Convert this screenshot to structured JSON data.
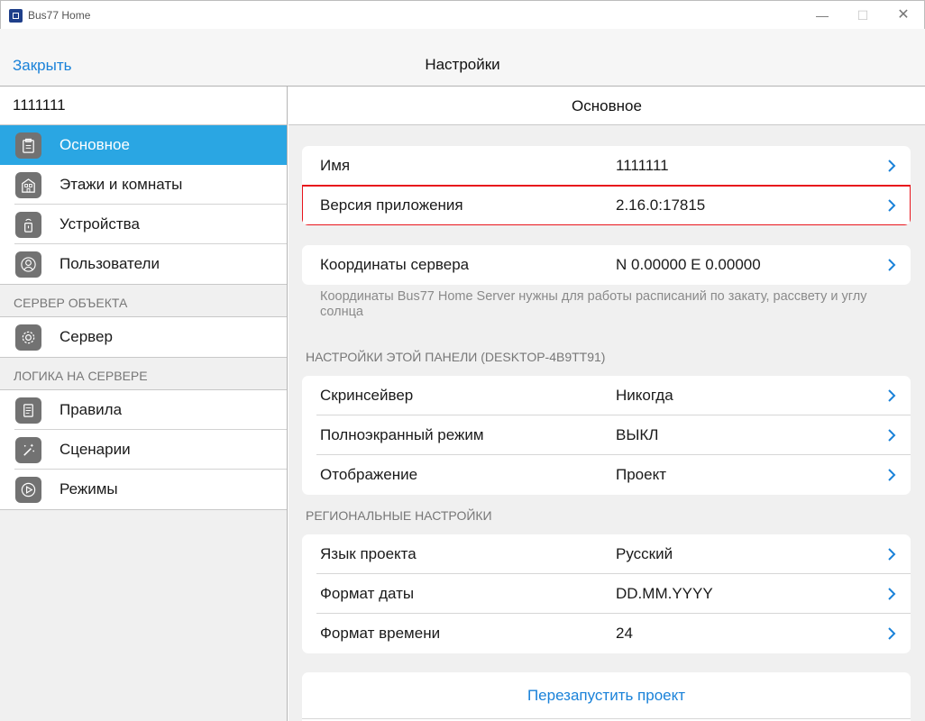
{
  "window": {
    "title": "Bus77 Home",
    "minimize": "—",
    "maximize": "☐",
    "close": "✕"
  },
  "nav": {
    "close_label": "Закрыть",
    "title": "Настройки"
  },
  "sidebar": {
    "header": "1111111",
    "items": [
      {
        "label": "Основное",
        "icon": "clipboard-icon"
      },
      {
        "label": "Этажи и комнаты",
        "icon": "building-icon"
      },
      {
        "label": "Устройства",
        "icon": "device-icon"
      },
      {
        "label": "Пользователи",
        "icon": "user-icon"
      }
    ],
    "section_server": "СЕРВЕР ОБЪЕКТА",
    "server_items": [
      {
        "label": "Сервер",
        "icon": "gear-icon"
      }
    ],
    "section_logic": "ЛОГИКА НА СЕРВЕРЕ",
    "logic_items": [
      {
        "label": "Правила",
        "icon": "document-icon"
      },
      {
        "label": "Сценарии",
        "icon": "magic-wand-icon"
      },
      {
        "label": "Режимы",
        "icon": "play-icon"
      }
    ]
  },
  "main": {
    "header": "Основное",
    "group1": [
      {
        "label": "Имя",
        "value": "1111111"
      },
      {
        "label": "Версия приложения",
        "value": "2.16.0:17815"
      }
    ],
    "group2": [
      {
        "label": "Координаты сервера",
        "value": "N 0.00000 E 0.00000"
      }
    ],
    "group2_note": "Координаты Bus77 Home Server нужны для работы расписаний по закату, рассвету и углу солнца",
    "section_panel": "НАСТРОЙКИ ЭТОЙ ПАНЕЛИ (DESKTOP-4B9TT91)",
    "group3": [
      {
        "label": "Скринсейвер",
        "value": "Никогда"
      },
      {
        "label": "Полноэкранный режим",
        "value": "ВЫКЛ"
      },
      {
        "label": "Отображение",
        "value": "Проект"
      }
    ],
    "section_regional": "РЕГИОНАЛЬНЫЕ НАСТРОЙКИ",
    "group4": [
      {
        "label": "Язык проекта",
        "value": "Русский"
      },
      {
        "label": "Формат даты",
        "value": "DD.MM.YYYY"
      },
      {
        "label": "Формат времени",
        "value": "24"
      }
    ],
    "restart_label": "Перезапустить проект"
  },
  "colors": {
    "accent": "#1a82d9",
    "active": "#2aa6e3",
    "highlight": "#e8141c"
  }
}
